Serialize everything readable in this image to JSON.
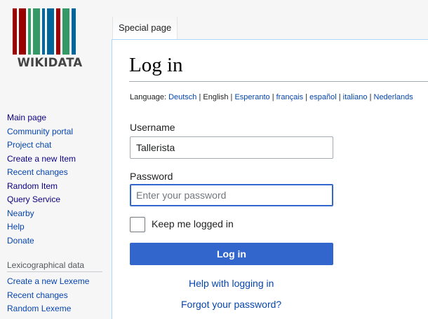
{
  "logo": {
    "text": "WIKIDATA",
    "bar_colors": [
      "#990000",
      "#990000",
      "#339966",
      "#339966",
      "#006699",
      "#006699",
      "#990000",
      "#339966",
      "#006699"
    ]
  },
  "sidebar": {
    "items": [
      {
        "label": "Main page"
      },
      {
        "label": "Community portal"
      },
      {
        "label": "Project chat"
      },
      {
        "label": "Create a new Item"
      },
      {
        "label": "Recent changes"
      },
      {
        "label": "Random Item"
      },
      {
        "label": "Query Service"
      },
      {
        "label": "Nearby"
      },
      {
        "label": "Help"
      },
      {
        "label": "Donate"
      }
    ],
    "lexico_heading": "Lexicographical data",
    "lexico_items": [
      {
        "label": "Create a new Lexeme"
      },
      {
        "label": "Recent changes"
      },
      {
        "label": "Random Lexeme"
      }
    ]
  },
  "tab": {
    "label": "Special page"
  },
  "main": {
    "title": "Log in",
    "language": {
      "prefix": "Language:",
      "items": [
        {
          "label": "Deutsch",
          "link": true
        },
        {
          "label": "English",
          "link": false
        },
        {
          "label": "Esperanto",
          "link": true
        },
        {
          "label": "français",
          "link": true
        },
        {
          "label": "español",
          "link": true
        },
        {
          "label": "italiano",
          "link": true
        },
        {
          "label": "Nederlands",
          "link": true
        }
      ],
      "separator": "|"
    },
    "username": {
      "label": "Username",
      "value": "Tallerista"
    },
    "password": {
      "label": "Password",
      "placeholder": "Enter your password"
    },
    "remember": {
      "label": "Keep me logged in"
    },
    "login_button": "Log in",
    "help_link": "Help with logging in",
    "forgot_link": "Forgot your password?"
  },
  "colors": {
    "accent": "#3366cc",
    "link": "#0645ad"
  }
}
